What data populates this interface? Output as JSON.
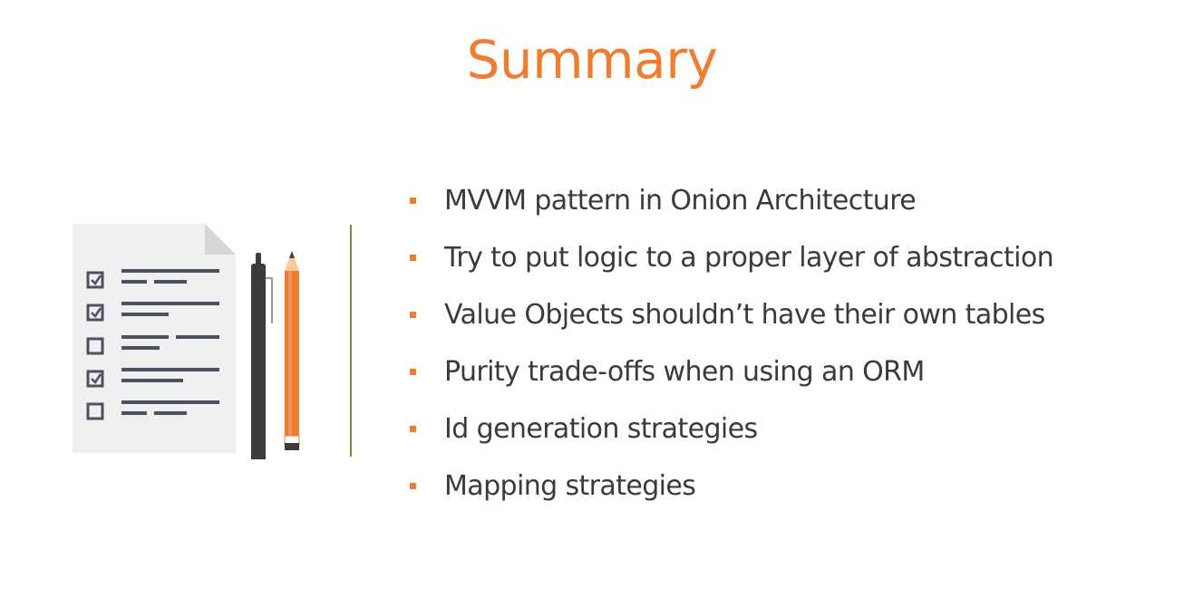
{
  "slide": {
    "title": "Summary",
    "bullets": [
      "MVVM pattern in Onion Architecture",
      "Try to put logic to a proper layer of abstraction",
      "Value Objects shouldn’t have their own tables",
      "Purity trade-offs when using an ORM",
      "Id generation strategies",
      "Mapping strategies"
    ]
  },
  "illustration": {
    "icons": [
      "checklist-document-icon",
      "pen-icon",
      "pencil-icon"
    ],
    "checklist_states": [
      true,
      true,
      false,
      true,
      false
    ]
  },
  "colors": {
    "accent": "#ee7c31",
    "body_text": "#3a3a3a",
    "divider": "#7d8a4a",
    "paper": "#f0f0f0",
    "ink": "#4a5260"
  }
}
